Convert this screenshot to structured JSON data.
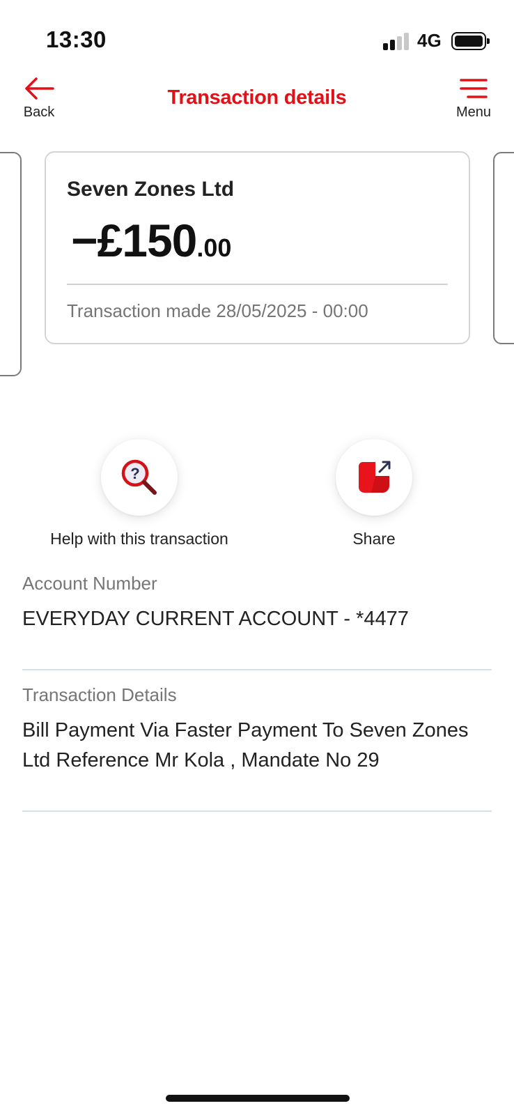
{
  "status_bar": {
    "time": "13:30",
    "network": "4G"
  },
  "header": {
    "back_label": "Back",
    "title": "Transaction details",
    "menu_label": "Menu"
  },
  "transaction": {
    "merchant": "Seven Zones Ltd",
    "amount_main": "−£150",
    "amount_pence": ".00",
    "date_label": "Transaction made",
    "date_value": "28/05/2025 - 00:00"
  },
  "actions": {
    "help_label": "Help with this transaction",
    "share_label": "Share"
  },
  "details": {
    "account_number_label": "Account Number",
    "account_number_value": "EVERYDAY CURRENT ACCOUNT - *4477",
    "transaction_details_label": "Transaction Details",
    "transaction_details_value": "Bill Payment Via Faster Payment To Seven Zones Ltd Reference Mr Kola , Mandate No 29"
  },
  "colors": {
    "brand_red": "#e01218",
    "text_primary": "#222222",
    "text_secondary": "#767676"
  },
  "icons": {
    "back": "arrow-left-icon",
    "menu": "hamburger-menu-icon",
    "help": "magnifier-question-icon",
    "share": "share-external-icon"
  }
}
